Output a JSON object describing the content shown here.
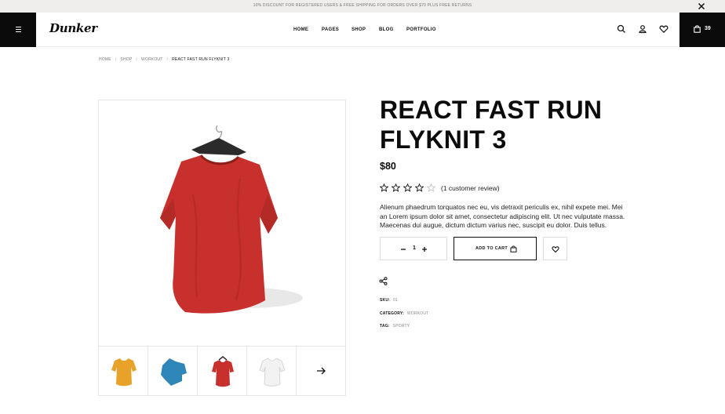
{
  "announcement": {
    "text": "10% DISCOUNT FOR REGISTERED USERS & FREE SHIPPING FOR ORDERS OVER $70 PLUS FREE RETURNS"
  },
  "header": {
    "logo": "Dunker",
    "nav": [
      "HOME",
      "PAGES",
      "SHOP",
      "BLOG",
      "PORTFOLIO"
    ],
    "cart_count": "39"
  },
  "breadcrumb": [
    "HOME",
    "SHOP",
    "WORKOUT",
    "REACT FAST RUN FLYKNIT 3"
  ],
  "gallery": {
    "main_color": "#c7302c",
    "thumbs": [
      {
        "color": "#e8a22a"
      },
      {
        "color": "#2f86b8"
      },
      {
        "color": "#c7302c"
      },
      {
        "color": "#f2f2f2"
      }
    ]
  },
  "product": {
    "title_line1": "REACT FAST RUN",
    "title_line2": "FLYKNIT 3",
    "price": "$80",
    "rating": 4,
    "rating_max": 5,
    "review_text": "(1 customer review)",
    "description": "Alienum phaedrum torquatos nec eu, vis detraxit periculis ex, nihil expete mei. Mei an Lorem ipsum dolor sit amet, consectetur adipiscing elit. Ut nec vulputate massa. Maecenas dui augue, dictum dictum varius nec, suscipit eu dolor. Duis tellus.",
    "quantity": "1",
    "add_to_cart": "ADD TO CART",
    "meta": {
      "sku_label": "SKU:",
      "sku": "01",
      "category_label": "CATEGORY:",
      "category": "WORKOUT",
      "tag_label": "TAG:",
      "tag": "SPORTY"
    }
  }
}
